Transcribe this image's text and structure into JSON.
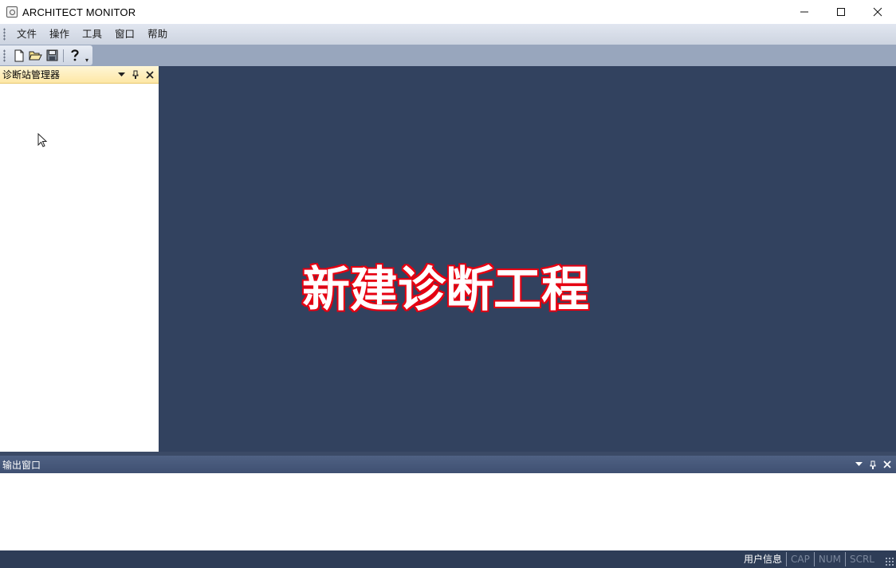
{
  "window": {
    "title": "ARCHITECT MONITOR",
    "controls": {
      "minimize": "—",
      "maximize": "☐",
      "close": "✕"
    }
  },
  "menu": {
    "items": [
      "文件",
      "操作",
      "工具",
      "窗口",
      "帮助"
    ]
  },
  "toolbar": {
    "buttons": [
      "new-file-icon",
      "open-folder-icon",
      "save-icon",
      "help-icon"
    ],
    "overflow_glyph": "▾"
  },
  "left_panel": {
    "title": "诊断站管理器",
    "btn_dropdown": "▾",
    "btn_pin": "ᵽ",
    "btn_close": "✕"
  },
  "workspace": {
    "overlay_text": "新建诊断工程"
  },
  "output_panel": {
    "title": "输出窗口",
    "btn_dropdown": "▾",
    "btn_pin": "ᵽ",
    "btn_close": "✕"
  },
  "statusbar": {
    "user_info": "用户信息",
    "cap": "CAP",
    "num": "NUM",
    "scrl": "SCRL"
  },
  "colors": {
    "workspace_bg": "#32425f",
    "overlay_stroke": "#e60012",
    "active_header": "#fde7a6",
    "statusbar_bg": "#2e3d57"
  }
}
